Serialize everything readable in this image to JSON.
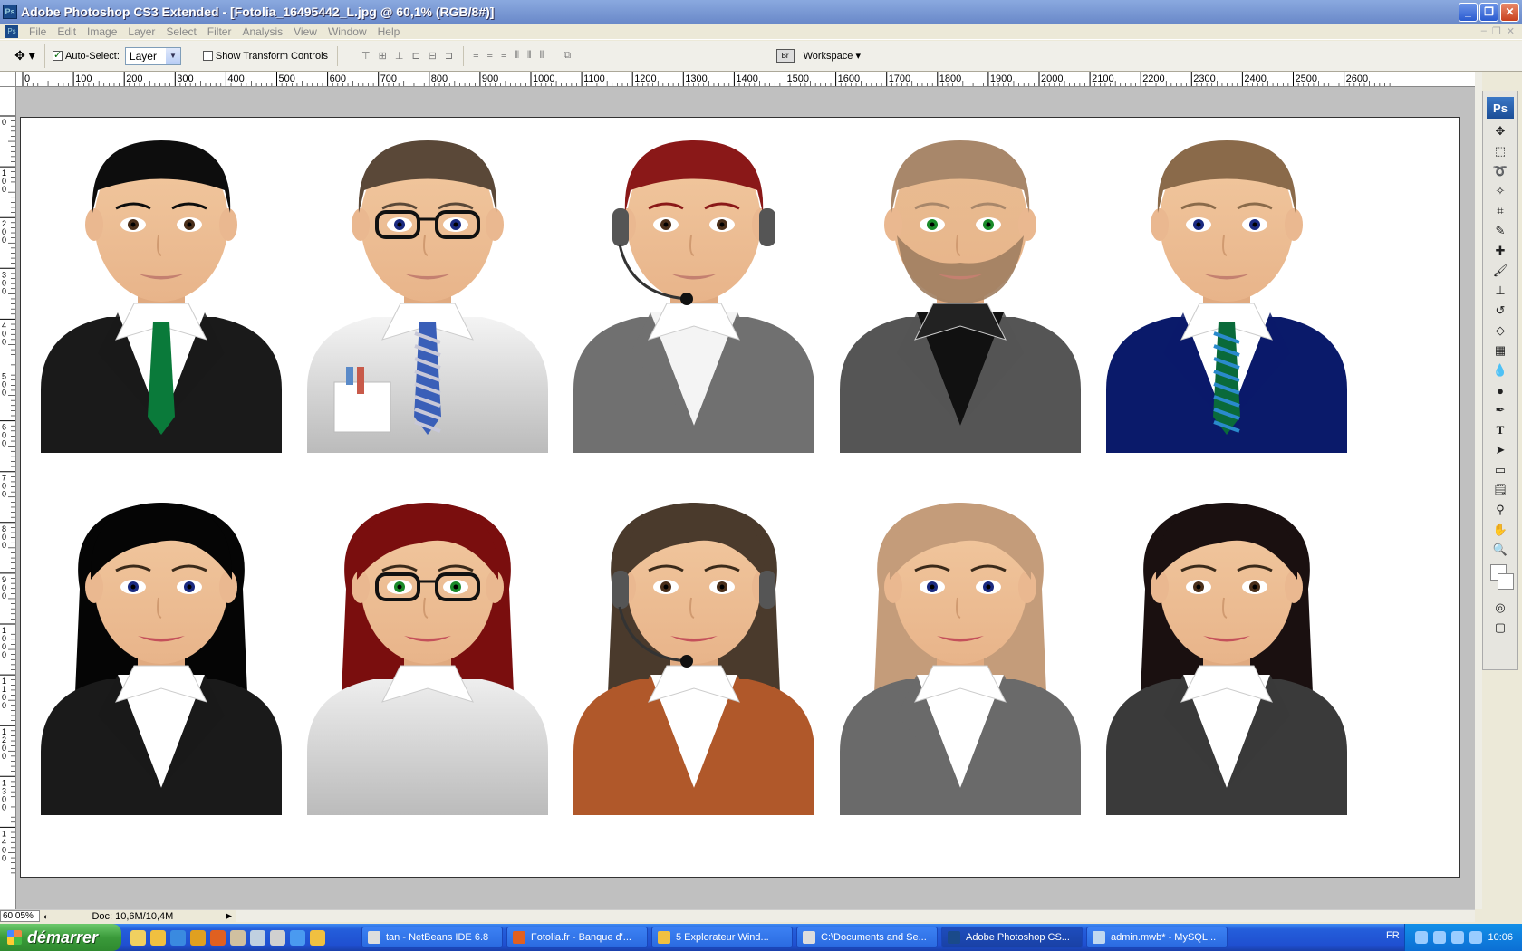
{
  "window": {
    "title": "Adobe Photoshop CS3 Extended - [Fotolia_16495442_L.jpg @ 60,1% (RGB/8#)]",
    "app_icon": "Ps",
    "buttons": [
      "minimize-icon",
      "restore-icon",
      "close-icon"
    ]
  },
  "menu": {
    "items": [
      "File",
      "Edit",
      "Image",
      "Layer",
      "Select",
      "Filter",
      "Analysis",
      "View",
      "Window",
      "Help"
    ]
  },
  "options": {
    "auto_select_label": "Auto-Select:",
    "auto_select_checked": true,
    "layer_select_value": "Layer",
    "show_transform_label": "Show Transform Controls",
    "show_transform_checked": false,
    "workspace_label": "Workspace"
  },
  "rulers": {
    "h_ticks": [
      "0",
      "100",
      "200",
      "300",
      "400",
      "500",
      "600",
      "700",
      "800",
      "900",
      "1000",
      "1100",
      "1200",
      "1300",
      "1400",
      "1500",
      "1600",
      "1700",
      "1800",
      "1900",
      "2000",
      "2100",
      "2200",
      "2300",
      "2400",
      "2500",
      "2600"
    ],
    "v_ticks": [
      "0",
      "1 0 0",
      "2 0 0",
      "3 0 0",
      "4 0 0",
      "5 0 0",
      "6 0 0",
      "7 0 0",
      "8 0 0",
      "9 0 0",
      "1 0 0 0",
      "1 1 0 0",
      "1 2 0 0",
      "1 3 0 0",
      "1 4 0 0"
    ]
  },
  "avatars": [
    {
      "gender": "male",
      "hair": "#0d0d0d",
      "skin": "#f2c9a0",
      "shirt": "#ffffff",
      "jacket": "#1a1a1a",
      "tie": "#0a7a3a",
      "tie_stripe": "",
      "eyes": "#4a2f1a",
      "glasses": false,
      "headset": false,
      "beard": false,
      "pocket": false
    },
    {
      "gender": "male",
      "hair": "#5a4838",
      "skin": "#f2c9a0",
      "shirt": "#f4f4f4",
      "jacket": "",
      "tie": "#3a5fb8",
      "tie_stripe": "#c8c8d8",
      "eyes": "#1a2a80",
      "glasses": true,
      "headset": false,
      "beard": false,
      "pocket": true
    },
    {
      "gender": "male",
      "hair": "#8a1818",
      "skin": "#f2c9a0",
      "shirt": "#f4f4f4",
      "jacket": "#707070",
      "tie": "",
      "tie_stripe": "",
      "eyes": "#4a2f1a",
      "glasses": false,
      "headset": true,
      "beard": false,
      "pocket": false
    },
    {
      "gender": "male",
      "hair": "#a8876a",
      "skin": "#e9bd92",
      "shirt": "#111111",
      "jacket": "#555555",
      "tie": "",
      "tie_stripe": "",
      "eyes": "#1a8a2a",
      "glasses": false,
      "headset": false,
      "beard": true,
      "pocket": false
    },
    {
      "gender": "male",
      "hair": "#8a6a4a",
      "skin": "#f2c9a0",
      "shirt": "#ffffff",
      "jacket": "#0a1a6a",
      "tie": "#0a6a3a",
      "tie_stripe": "#2a8acc",
      "eyes": "#1a2a80",
      "glasses": false,
      "headset": false,
      "beard": false,
      "pocket": false
    },
    {
      "gender": "female",
      "hair": "#050505",
      "skin": "#f2c9a0",
      "shirt": "#ffffff",
      "jacket": "#1a1a1a",
      "tie": "",
      "tie_stripe": "",
      "eyes": "#1a2a80",
      "glasses": false,
      "headset": false,
      "beard": false,
      "pocket": false
    },
    {
      "gender": "female",
      "hair": "#7a0e0e",
      "skin": "#f2c9a0",
      "shirt": "#eeeeee",
      "jacket": "",
      "tie": "",
      "tie_stripe": "",
      "eyes": "#1a8a2a",
      "glasses": true,
      "headset": false,
      "beard": false,
      "pocket": false
    },
    {
      "gender": "female",
      "hair": "#4a3a2c",
      "skin": "#f2c9a0",
      "shirt": "#ffffff",
      "jacket": "#b0582a",
      "tie": "",
      "tie_stripe": "",
      "eyes": "#4a2f1a",
      "glasses": false,
      "headset": true,
      "beard": false,
      "pocket": false
    },
    {
      "gender": "female",
      "hair": "#c49c7a",
      "skin": "#f2c9a0",
      "shirt": "#ffffff",
      "jacket": "#6a6a6a",
      "tie": "",
      "tie_stripe": "",
      "eyes": "#1a2a80",
      "glasses": false,
      "headset": false,
      "beard": false,
      "pocket": false
    },
    {
      "gender": "female",
      "hair": "#1a1010",
      "skin": "#f2c9a0",
      "shirt": "#ffffff",
      "jacket": "#3a3a3a",
      "tie": "",
      "tie_stripe": "",
      "eyes": "#4a2f1a",
      "glasses": false,
      "headset": false,
      "beard": false,
      "pocket": false
    }
  ],
  "tools": [
    "move-icon",
    "marquee-icon",
    "lasso-icon",
    "magic-wand-icon",
    "crop-icon",
    "slice-icon",
    "healing-icon",
    "brush-icon",
    "stamp-icon",
    "history-brush-icon",
    "eraser-icon",
    "gradient-icon",
    "blur-icon",
    "dodge-icon",
    "pen-icon",
    "type-icon",
    "path-select-icon",
    "shape-icon",
    "notes-icon",
    "eyedropper-icon",
    "hand-icon",
    "zoom-icon"
  ],
  "status": {
    "zoom": "60,05%",
    "doc_size": "Doc: 10,6M/10,4M"
  },
  "taskbar": {
    "start_label": "démarrer",
    "tasks": [
      "tan - NetBeans IDE 6.8",
      "Fotolia.fr - Banque d'...",
      "5 Explorateur Wind...",
      "C:\\Documents and Se...",
      "Adobe Photoshop CS...",
      "admin.mwb* - MySQL..."
    ],
    "active_task": 4,
    "language": "FR",
    "clock": "10:06"
  }
}
